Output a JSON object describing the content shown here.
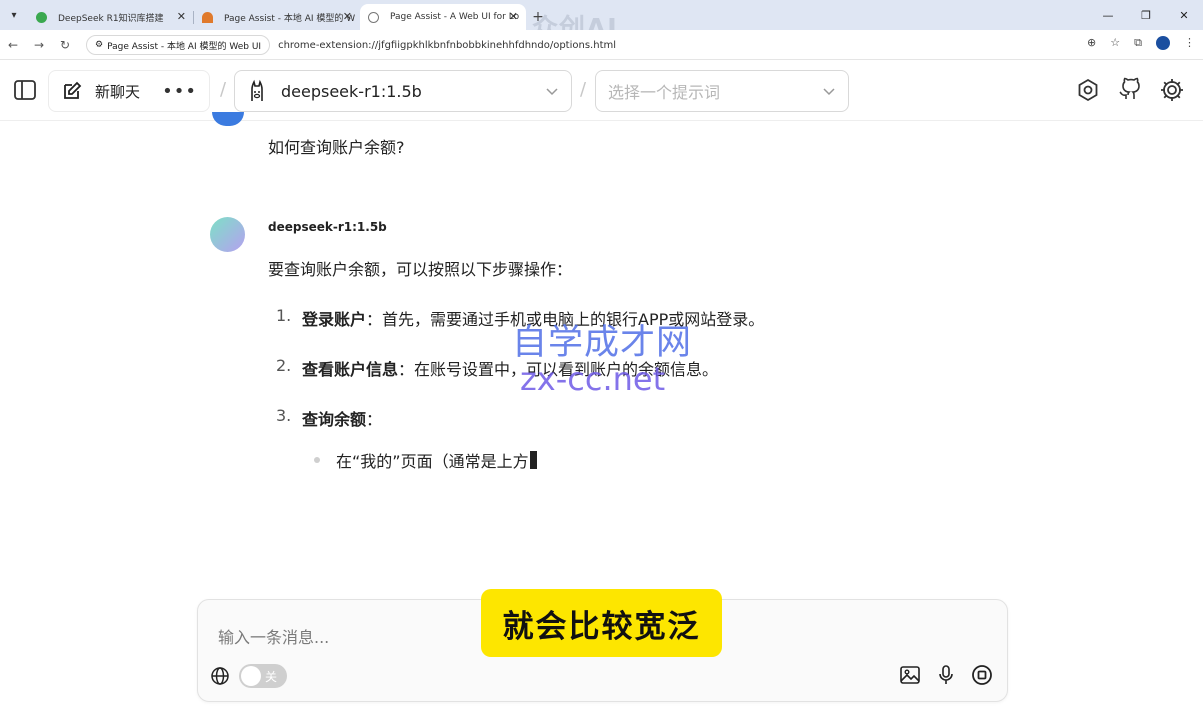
{
  "browser": {
    "tabs": [
      {
        "title": "DeepSeek R1知识库搭建",
        "favicon_color": "#3aa84f",
        "active": false
      },
      {
        "title": "Page Assist - 本地 AI 模型的 W",
        "favicon_color": "#e07a2c",
        "active": false
      },
      {
        "title": "Page Assist - A Web UI for Lo",
        "favicon_color": "#9aa3ad",
        "active": true
      }
    ],
    "new_tab_glyph": "+",
    "watermark": "众创AI",
    "chip_label": "Page Assist - 本地 AI 模型的 Web UI",
    "url": "chrome-extension://jfgfiigpkhlkbnfnbobbkinehhfdhndo/options.html"
  },
  "header": {
    "new_chat_label": "新聊天",
    "more_glyph": "•••",
    "model_name": "deepseek-r1:1.5b",
    "prompt_placeholder": "选择一个提示词"
  },
  "chat": {
    "user_message": "如何查询账户余额?",
    "bot_name": "deepseek-r1:1.5b",
    "bot_intro": "要查询账户余额，可以按照以下步骤操作：",
    "steps": [
      {
        "num": "1.",
        "title": "登录账户",
        "text": "：首先，需要通过手机或电脑上的银行APP或网站登录。"
      },
      {
        "num": "2.",
        "title": "查看账户信息",
        "text": "：在账号设置中，可以看到账户的余额信息。"
      },
      {
        "num": "3.",
        "title": "查询余额",
        "text": "："
      }
    ],
    "sub_bullet": "在“我的”页面（通常是上方"
  },
  "overlay": {
    "watermark_line1": "自学成才网",
    "watermark_line2": "zx-cc.net",
    "subtitle": "就会比较宽泛"
  },
  "input": {
    "placeholder": "输入一条消息...",
    "toggle_label": "关",
    "toggle_on": false
  },
  "colors": {
    "accent_user": "#3b7be0",
    "subtitle_bg": "#fde600"
  }
}
